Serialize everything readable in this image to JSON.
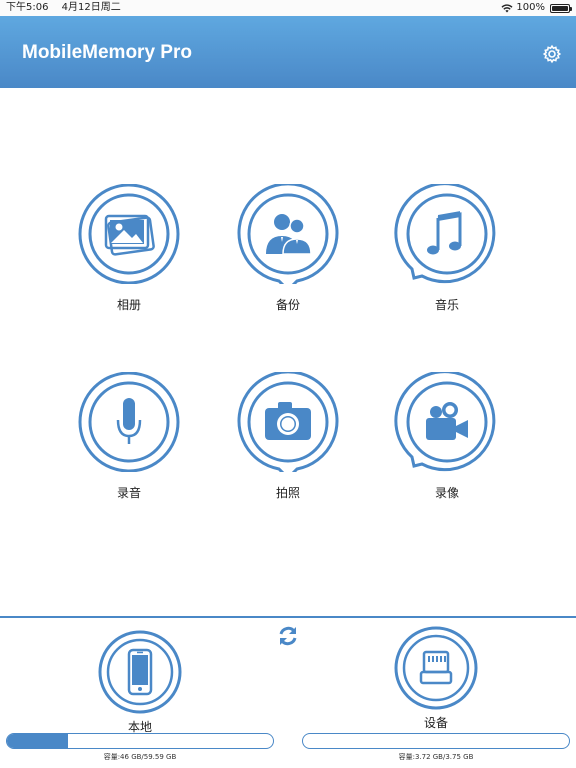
{
  "status": {
    "time": "下午5:06",
    "date": "4月12日周二",
    "battery_text": "100%",
    "battery_level": 1.0
  },
  "app": {
    "title": "MobileMemory Pro"
  },
  "colors": {
    "accent": "#4a88c7",
    "nav_top": "#5fa8e0"
  },
  "tiles": [
    {
      "label": "相册",
      "icon": "photo-album-icon"
    },
    {
      "label": "备份",
      "icon": "backup-contacts-icon"
    },
    {
      "label": "音乐",
      "icon": "music-note-icon"
    },
    {
      "label": "录音",
      "icon": "microphone-icon"
    },
    {
      "label": "拍照",
      "icon": "camera-icon"
    },
    {
      "label": "录像",
      "icon": "video-camera-icon"
    }
  ],
  "storage": {
    "local": {
      "label": "本地",
      "capacity": "容量:46 GB/59.59 GB",
      "used_fraction": 0.23
    },
    "device": {
      "label": "设备",
      "capacity": "容量:3.72 GB/3.75 GB",
      "used_fraction": 0.0
    }
  }
}
